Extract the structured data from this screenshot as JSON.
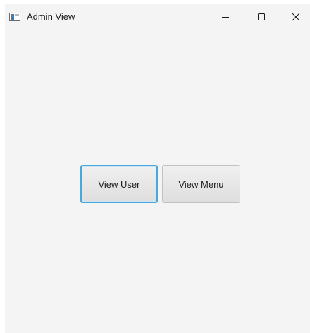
{
  "window": {
    "title": "Admin View",
    "icon": "java-app-icon",
    "controls": {
      "minimize": "minimize-icon",
      "maximize": "maximize-icon",
      "close": "close-icon"
    }
  },
  "buttons": {
    "view_user": "View User",
    "view_menu": "View Menu"
  },
  "colors": {
    "background": "#f4f4f4",
    "focus_border": "#49a7dc"
  }
}
